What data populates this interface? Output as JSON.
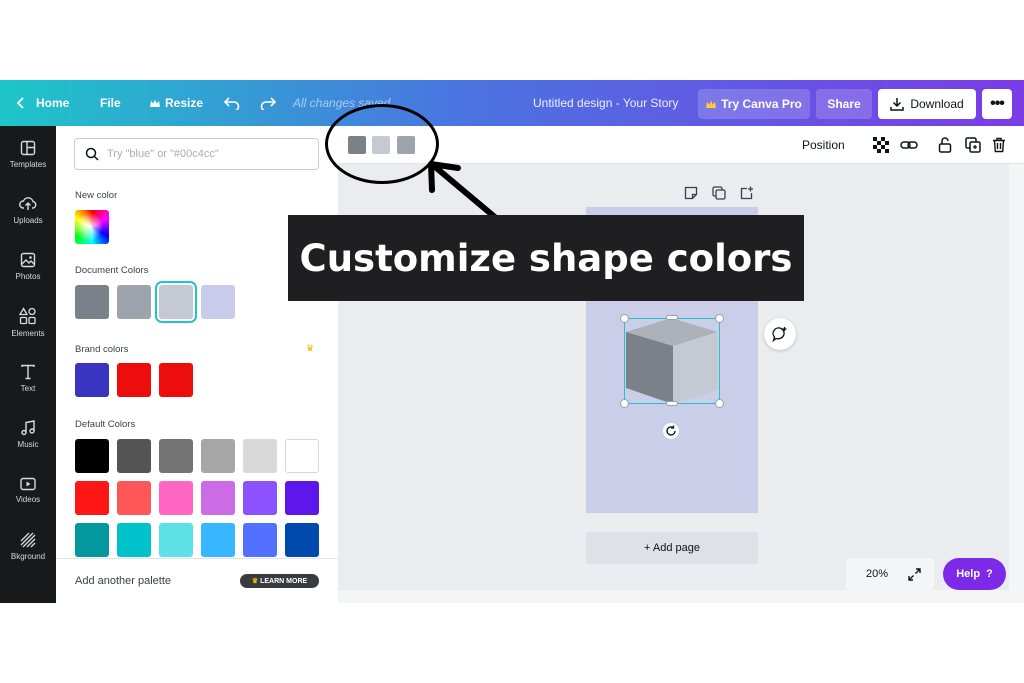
{
  "topbar": {
    "home_label": "Home",
    "file_label": "File",
    "resize_label": "Resize",
    "saved_status": "All changes saved",
    "design_title": "Untitled design - Your Story",
    "try_pro_label": "Try Canva Pro",
    "share_label": "Share",
    "download_label": "Download",
    "more_label": "•••"
  },
  "sidebar": {
    "items": [
      {
        "label": "Templates",
        "icon": "templates-icon"
      },
      {
        "label": "Uploads",
        "icon": "uploads-icon"
      },
      {
        "label": "Photos",
        "icon": "photos-icon"
      },
      {
        "label": "Elements",
        "icon": "elements-icon"
      },
      {
        "label": "Text",
        "icon": "text-icon"
      },
      {
        "label": "Music",
        "icon": "music-icon"
      },
      {
        "label": "Videos",
        "icon": "videos-icon"
      },
      {
        "label": "Bkground",
        "icon": "background-icon"
      }
    ]
  },
  "color_panel": {
    "search_placeholder": "Try \"blue\" or \"#00c4cc\"",
    "new_color_label": "New color",
    "document_colors_label": "Document Colors",
    "document_colors": [
      "#7b8189",
      "#9ea4ad",
      "#c4c9d4",
      "#c8cbea"
    ],
    "selected_document_color_index": 2,
    "brand_colors_label": "Brand colors",
    "brand_colors": [
      "#3a35c0",
      "#ee0d0d",
      "#ee0d0d"
    ],
    "default_colors_label": "Default Colors",
    "default_colors": [
      "#000000",
      "#545454",
      "#737373",
      "#a6a6a6",
      "#d9d9d9",
      "#ffffff",
      "#ff1616",
      "#ff5757",
      "#ff66c4",
      "#cb6ce6",
      "#8c52ff",
      "#5e17eb",
      "#03989e",
      "#00c2cb",
      "#5ce1e6",
      "#38b6ff",
      "#5271ff",
      "#004aad"
    ],
    "add_palette_label": "Add another palette",
    "learn_more_label": "LEARN MORE"
  },
  "context_bar": {
    "shape_colors": [
      "#7b8189",
      "#c4c9d4",
      "#9ea4ad"
    ],
    "position_label": "Position"
  },
  "canvas": {
    "page_background": "#cbcee8",
    "cube_colors": {
      "top": "#adb2ba",
      "left": "#7b8189",
      "right": "#c4c9d4"
    },
    "add_page_label": "+ Add page",
    "zoom_label": "20%",
    "help_label": "Help",
    "help_icon_label": "?"
  },
  "annotation": {
    "banner_text": "Customize shape colors"
  }
}
